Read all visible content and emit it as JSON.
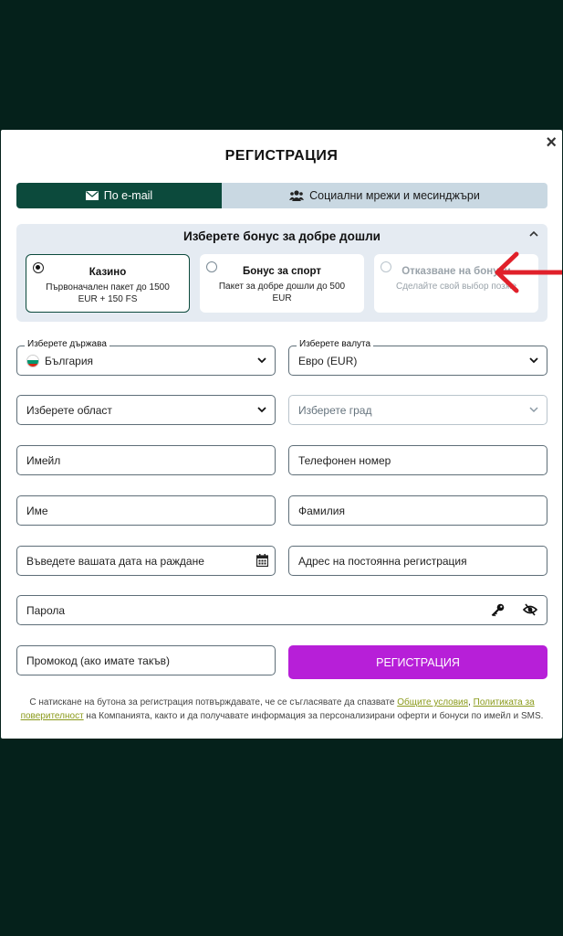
{
  "modal": {
    "title": "РЕГИСТРАЦИЯ",
    "close_label": "×"
  },
  "tabs": [
    {
      "label": "По e-mail",
      "icon": "envelope-icon",
      "active": true
    },
    {
      "label": "Социални мрежи и месинджъри",
      "icon": "users-icon",
      "active": false
    }
  ],
  "bonus": {
    "header": "Изберете бонус за добре дошли",
    "cards": [
      {
        "title": "Казино",
        "desc": "Първоначален пакет до 1500 EUR + 150 FS",
        "selected": true
      },
      {
        "title": "Бонус за спорт",
        "desc": "Пакет за добре дошли до 500 EUR",
        "selected": false
      },
      {
        "title": "Отказване на бонуси",
        "desc": "Сделайте свой выбор позже",
        "selected": false
      }
    ]
  },
  "form": {
    "country_label": "Изберете държава",
    "country_value": "България",
    "currency_label": "Изберете валута",
    "currency_value": "Евро (EUR)",
    "region_placeholder": "Изберете област",
    "city_placeholder": "Изберете град",
    "email_placeholder": "Имейл",
    "phone_placeholder": "Телефонен номер",
    "first_name_placeholder": "Име",
    "last_name_placeholder": "Фамилия",
    "birthdate_placeholder": "Въведете вашата дата на раждане",
    "address_placeholder": "Адрес на постоянна регистрация",
    "password_placeholder": "Парола",
    "promo_placeholder": "Промокод (ако имате такъв)",
    "submit_label": "РЕГИСТРАЦИЯ"
  },
  "terms": {
    "text_before": "С натискане на бутона за регистрация потвърждавате, че се съгласявате да спазвате ",
    "link_terms": "Общите условия",
    "sep": ", ",
    "link_policy": "Политиката за поверителност",
    "text_after": " на Компанията, както и да получавате информация за персонализирани оферти и бонуси по имейл и SMS."
  },
  "colors": {
    "background": "#05211b",
    "tab_active": "#0c4a3c",
    "submit": "#b71fd8",
    "arrow": "#e0202a",
    "link": "#8a9a1a"
  }
}
